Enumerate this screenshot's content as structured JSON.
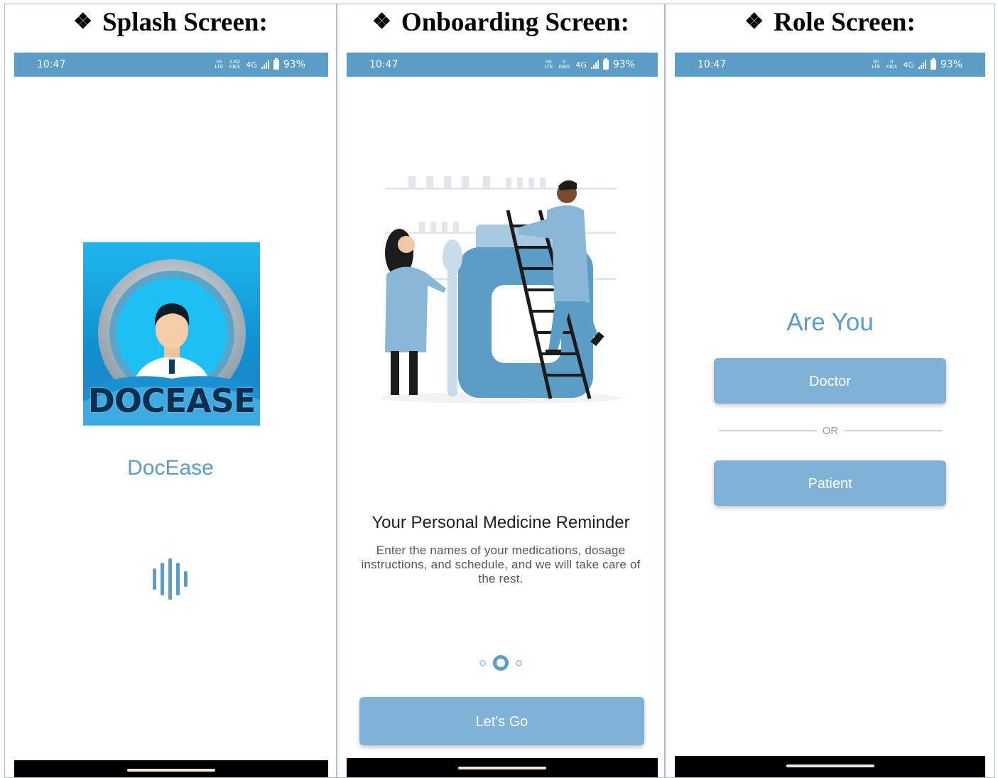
{
  "panels": {
    "splash": {
      "heading": "Splash Screen:"
    },
    "onboarding": {
      "heading": "Onboarding Screen:"
    },
    "role": {
      "heading": "Role Screen:"
    }
  },
  "status_bar": {
    "time": "10:47",
    "volte": "Vo LTE",
    "speed_splash_value": "2.62",
    "speed_value": "0",
    "speed_unit": "KB/s",
    "network": "4G",
    "battery": "93%"
  },
  "splash": {
    "logo_text": "DOCEASE",
    "app_name": "DocEase",
    "loader_icon": "audio-wave-icon"
  },
  "onboarding": {
    "title": "Your Personal Medicine Reminder",
    "description": "Enter the names of your medications, dosage instructions, and schedule, and we will take care of the rest.",
    "page_indicator": {
      "count": 3,
      "active": 2
    },
    "button_label": "Let's Go"
  },
  "role": {
    "title": "Are You",
    "doctor_label": "Doctor",
    "separator": "OR",
    "patient_label": "Patient"
  },
  "colors": {
    "status_bar": "#5b9dc7",
    "primary_text": "#5b9dc7",
    "button": "#7fb2d7",
    "navbar": "#000000"
  }
}
